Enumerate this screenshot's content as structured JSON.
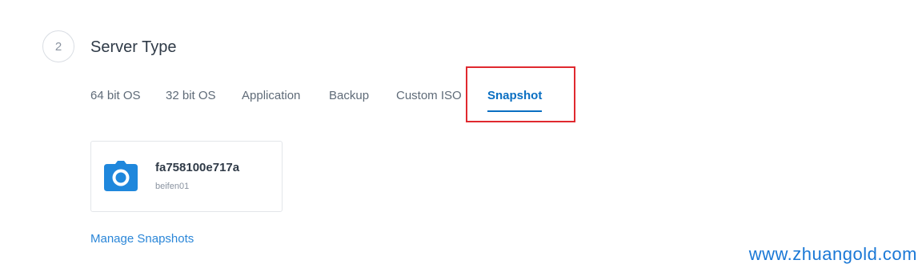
{
  "section": {
    "step_number": "2",
    "title": "Server Type"
  },
  "tabs": [
    {
      "label": "64 bit OS",
      "active": false
    },
    {
      "label": "32 bit OS",
      "active": false
    },
    {
      "label": "Application",
      "active": false
    },
    {
      "label": "Backup",
      "active": false
    },
    {
      "label": "Custom ISO",
      "active": false
    },
    {
      "label": "Snapshot",
      "active": true
    }
  ],
  "snapshot_card": {
    "icon": "camera-icon",
    "id": "fa758100e717a",
    "label": "beifen01"
  },
  "manage_link": "Manage Snapshots",
  "watermark": "www.zhuangold.com",
  "colors": {
    "accent": "#0a6fc2",
    "link": "#2a86d8",
    "highlight": "#e0292f"
  }
}
